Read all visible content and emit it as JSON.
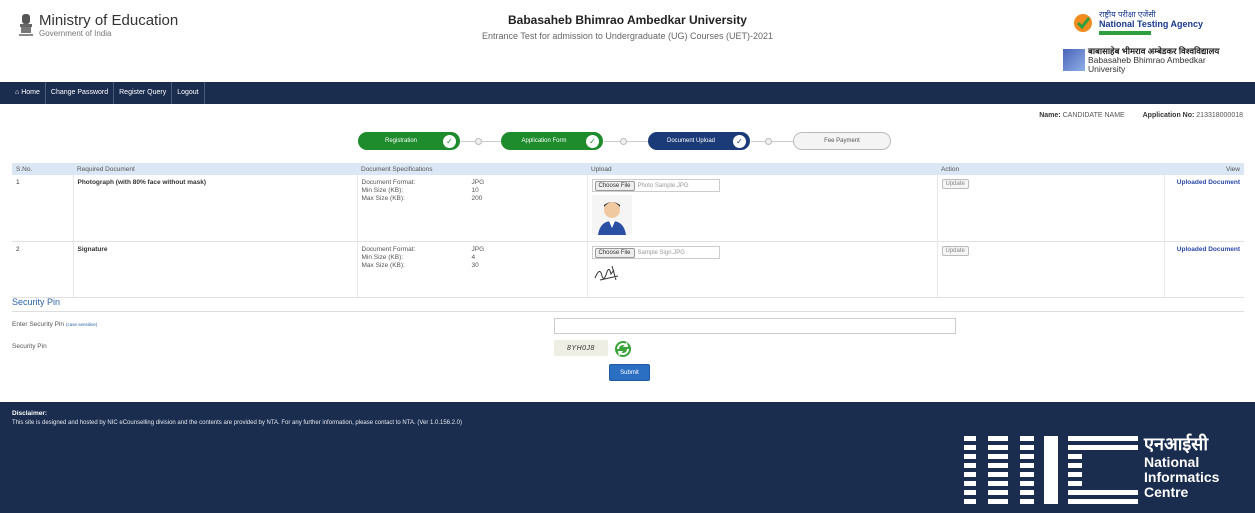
{
  "header": {
    "ministry_title": "Ministry of Education",
    "ministry_sub": "Government of India",
    "university_title": "Babasaheb Bhimrao Ambedkar University",
    "university_sub": "Entrance Test for admission to Undergraduate (UG) Courses (UET)-2021",
    "nta_hindi": "राष्ट्रीय परीक्षा एजेंसी",
    "nta_english": "National Testing Agency",
    "bbau_hindi": "बाबासाहेब भीमराव अम्बेडकर विश्वविद्यालय",
    "bbau_english_1": "Babasaheb Bhimrao Ambedkar",
    "bbau_english_2": "University"
  },
  "nav": {
    "items": [
      {
        "label": "Home",
        "icon": "home-icon"
      },
      {
        "label": "Change Password"
      },
      {
        "label": "Register Query"
      },
      {
        "label": "Logout"
      }
    ]
  },
  "candidate": {
    "name_label": "Name:",
    "name_value": "CANDIDATE NAME",
    "appno_label": "Application No:",
    "appno_value": "213318000018"
  },
  "stepper": {
    "steps": [
      {
        "label": "Registration",
        "state": "completed"
      },
      {
        "label": "Application Form",
        "state": "completed"
      },
      {
        "label": "Document Upload",
        "state": "current"
      },
      {
        "label": "Fee Payment",
        "state": "pending"
      }
    ],
    "check_glyph": "✓"
  },
  "table": {
    "headers": [
      "S.No.",
      "Required Document",
      "Document Specifications",
      "Upload",
      "Action",
      "View"
    ],
    "rows": [
      {
        "sno": "1",
        "document": "Photograph (with 80% face without mask)",
        "specs": [
          {
            "k": "Document Format:",
            "v": "JPG"
          },
          {
            "k": "Min Size (KB):",
            "v": "10"
          },
          {
            "k": "Max Size (KB):",
            "v": "200"
          }
        ],
        "choose_label": "Choose File",
        "filename": "Photo Sample.JPG",
        "action_label": "Update",
        "view_label": "Uploaded Document"
      },
      {
        "sno": "2",
        "document": "Signature",
        "specs": [
          {
            "k": "Document Format:",
            "v": "JPG"
          },
          {
            "k": "Min Size (KB):",
            "v": "4"
          },
          {
            "k": "Max Size (KB):",
            "v": "30"
          }
        ],
        "choose_label": "Choose File",
        "filename": "Sample Sign.JPG",
        "action_label": "Update",
        "view_label": "Uploaded Document"
      }
    ]
  },
  "security": {
    "title": "Security Pin",
    "enter_label": "Enter Security Pin",
    "case_note": "(case sensitive)",
    "pin_label": "Security Pin",
    "captcha_text": "8YH0J8",
    "submit_label": "Submit"
  },
  "footer": {
    "disclaimer_title": "Disclaimer:",
    "disclaimer_text": "This site is designed and hosted by NIC eCounselling division and the contents are provided by NTA. For any further information, please contact to NTA. (Ver 1.0.156.2.0)",
    "nic_hindi": "एनआईसी",
    "nic_en_1": "National",
    "nic_en_2": "Informatics",
    "nic_en_3": "Centre"
  },
  "colors": {
    "navy": "#1b2d4f",
    "green": "#1e8c2c",
    "blue": "#1b3b78",
    "link": "#2a48a6"
  }
}
